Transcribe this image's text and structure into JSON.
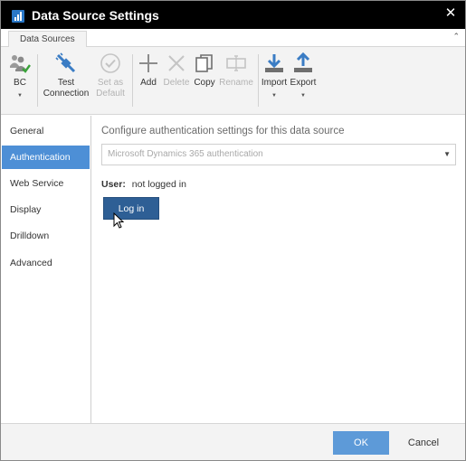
{
  "window": {
    "title": "Data Source Settings",
    "close_glyph": "✕"
  },
  "ribbon": {
    "tab_label": "Data Sources",
    "collapse_glyph": "⌃",
    "buttons": [
      {
        "name": "bc",
        "label": "BC",
        "icon": "people-check-icon",
        "disabled": false,
        "has_dropdown": true
      },
      {
        "name": "test-connection",
        "label": "Test Connection",
        "icon": "connection-plug-icon",
        "disabled": false,
        "has_dropdown": false
      },
      {
        "name": "set-as-default",
        "label": "Set as Default",
        "icon": "check-circle-icon",
        "disabled": true,
        "has_dropdown": false
      },
      {
        "name": "add",
        "label": "Add",
        "icon": "plus-icon",
        "disabled": false,
        "has_dropdown": false
      },
      {
        "name": "delete",
        "label": "Delete",
        "icon": "x-icon",
        "disabled": true,
        "has_dropdown": false
      },
      {
        "name": "copy",
        "label": "Copy",
        "icon": "copy-icon",
        "disabled": false,
        "has_dropdown": false
      },
      {
        "name": "rename",
        "label": "Rename",
        "icon": "rename-icon",
        "disabled": true,
        "has_dropdown": false
      },
      {
        "name": "import",
        "label": "Import",
        "icon": "download-tray-icon",
        "disabled": false,
        "has_dropdown": true
      },
      {
        "name": "export",
        "label": "Export",
        "icon": "upload-tray-icon",
        "disabled": false,
        "has_dropdown": true
      }
    ],
    "labels": {
      "bc": "BC",
      "test1": "Test",
      "test2": "Connection",
      "setdef1": "Set as",
      "setdef2": "Default",
      "add": "Add",
      "delete": "Delete",
      "copy": "Copy",
      "rename": "Rename",
      "import": "Import",
      "export": "Export"
    },
    "dropdown_glyph": "▼"
  },
  "nav": {
    "items": [
      {
        "label": "General",
        "active": false
      },
      {
        "label": "Authentication",
        "active": true
      },
      {
        "label": "Web Service",
        "active": false
      },
      {
        "label": "Display",
        "active": false
      },
      {
        "label": "Drilldown",
        "active": false
      },
      {
        "label": "Advanced",
        "active": false
      }
    ]
  },
  "main": {
    "heading": "Configure authentication settings for this data source",
    "auth_select_value": "Microsoft Dynamics 365 authentication",
    "dropdown_glyph": "▼",
    "user_label": "User:",
    "user_value": "not logged in",
    "login_label": "Log in"
  },
  "footer": {
    "ok_label": "OK",
    "cancel_label": "Cancel"
  },
  "colors": {
    "titlebar": "#000000",
    "accent": "#4d8fd6",
    "login_button": "#2e5f95",
    "ok_button": "#5d9ad8",
    "ribbon_bg": "#f3f3f3",
    "disabled_text": "#b3b3b3"
  }
}
